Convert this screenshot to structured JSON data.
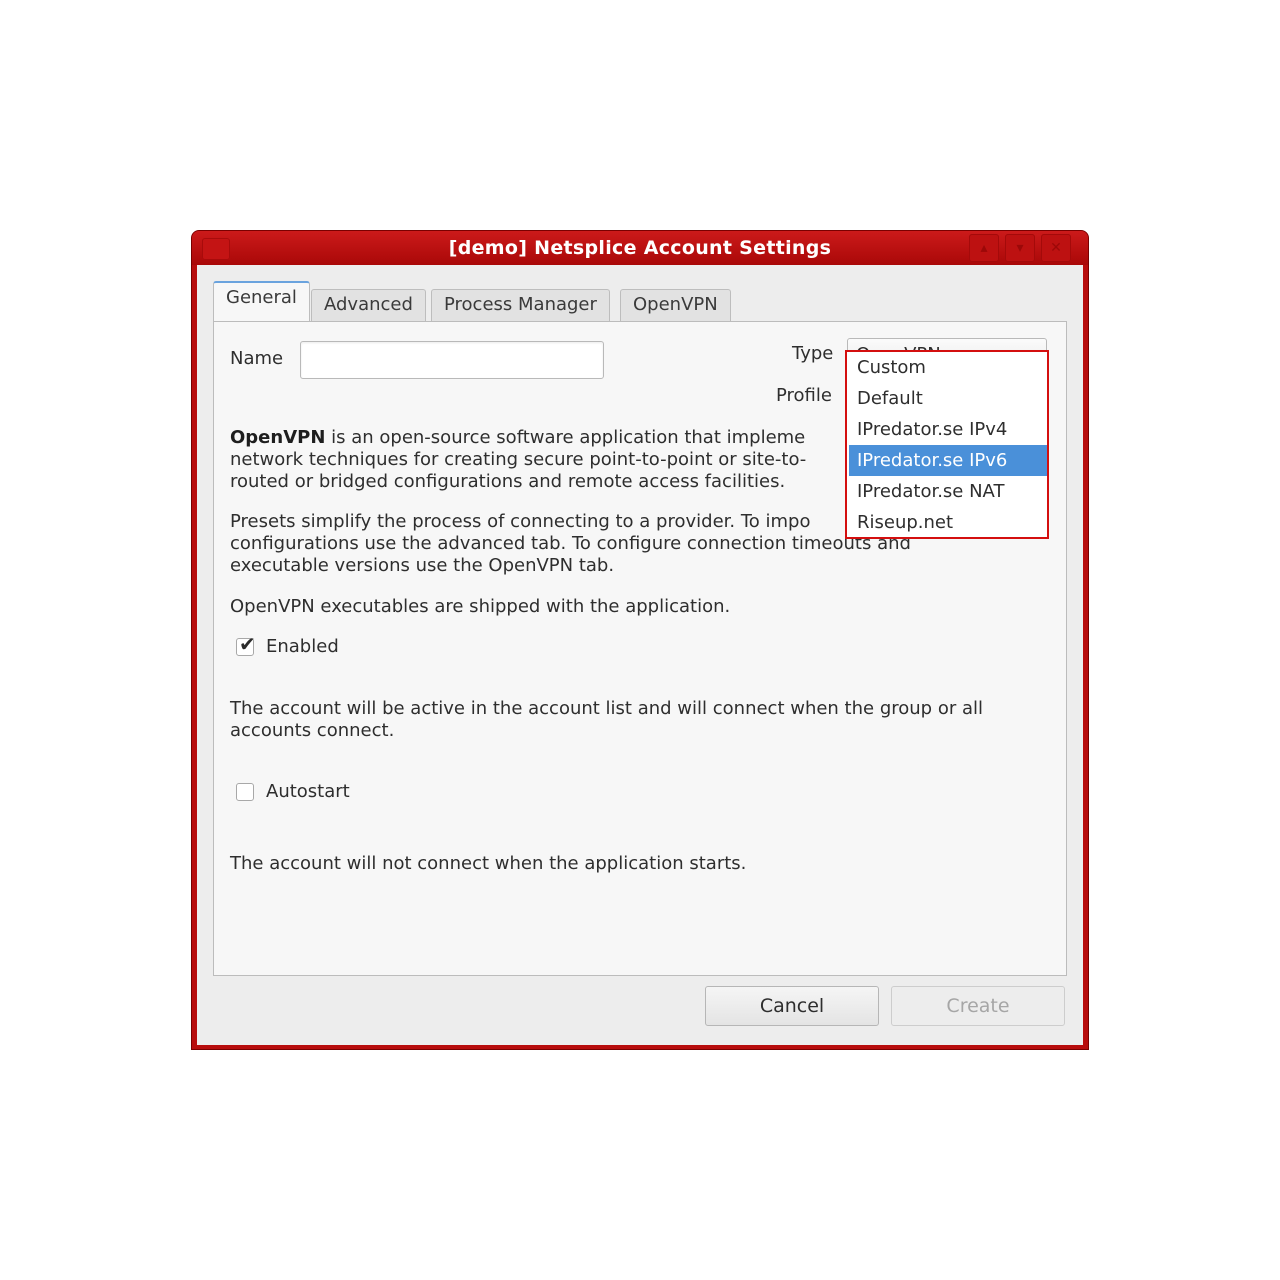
{
  "window": {
    "title": "[demo] Netsplice Account Settings"
  },
  "tabs": [
    {
      "label": "General",
      "active": true
    },
    {
      "label": "Advanced",
      "active": false
    },
    {
      "label": "Process Manager",
      "active": false
    },
    {
      "label": "OpenVPN",
      "active": false
    }
  ],
  "form": {
    "name_label": "Name",
    "name_value": "",
    "type_label": "Type",
    "type_value": "OpenVPN",
    "profile_label": "Profile"
  },
  "description": {
    "openvpn_bold": "OpenVPN",
    "openvpn_line1": " is an open-source software application that impleme",
    "openvpn_line2": "network techniques for creating secure point-to-point or site-to-",
    "openvpn_line3": "routed or bridged configurations and remote access facilities.",
    "presets_line1": "Presets simplify the process of connecting to a provider. To impo",
    "presets_line2": "configurations use the advanced tab. To configure connection timeouts and",
    "presets_line3": "executable versions use the OpenVPN tab.",
    "shipped": "OpenVPN executables are shipped with the application."
  },
  "enabled": {
    "label": "Enabled",
    "checked": true,
    "help": "The account will be active in the account list and will connect when the group or all accounts connect."
  },
  "autostart": {
    "label": "Autostart",
    "checked": false,
    "help": "The account will not connect when the application starts."
  },
  "buttons": {
    "cancel": "Cancel",
    "create": "Create"
  },
  "profile_dropdown": {
    "options": [
      "Custom",
      "Default",
      "IPredator.se IPv4",
      "IPredator.se IPv6",
      "IPredator.se NAT",
      "Riseup.net"
    ],
    "selected_index": 3
  },
  "colors": {
    "titlebar": "#b80d0d",
    "selection": "#4a90d9",
    "popup_border": "#d40f0f"
  }
}
